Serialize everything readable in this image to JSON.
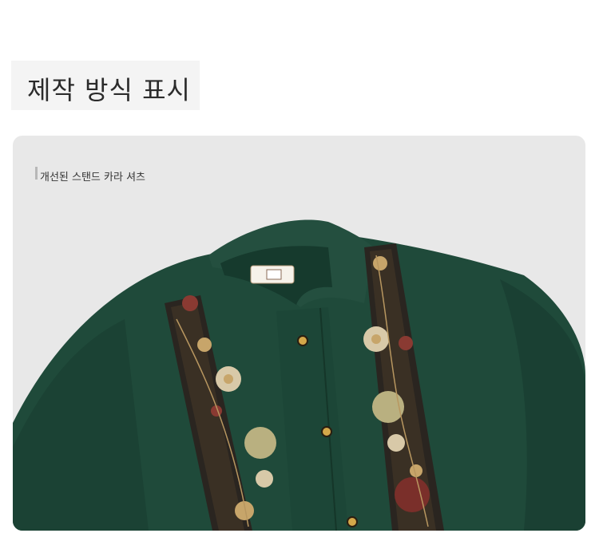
{
  "heading": {
    "title": "제작 방식 표시"
  },
  "product": {
    "caption": "개선된 스탠드 카라 셔츠"
  },
  "colors": {
    "background": "#ffffff",
    "heading_box": "#f4f4f4",
    "card_background": "#e8e8e8",
    "shirt_green": "#1f4a3a",
    "embroidery_gold": "#c7a56a",
    "embroidery_red": "#8a3a32"
  }
}
